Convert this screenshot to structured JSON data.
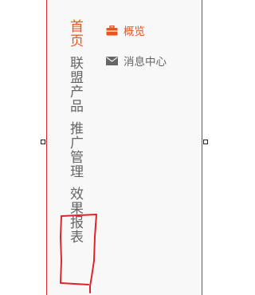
{
  "main_nav": {
    "items": [
      {
        "label": "首页",
        "active": true
      },
      {
        "label": "联盟产品",
        "active": false
      },
      {
        "label": "推广管理",
        "active": false
      },
      {
        "label": "效果报表",
        "active": false
      }
    ]
  },
  "sub_nav": {
    "items": [
      {
        "label": "概览",
        "icon": "briefcase-icon",
        "active": true
      },
      {
        "label": "消息中心",
        "icon": "envelope-icon",
        "active": false
      }
    ]
  },
  "colors": {
    "accent": "#e8541e",
    "text": "#666666",
    "selection_border": "#e0222a",
    "annotation": "#e0222a"
  }
}
